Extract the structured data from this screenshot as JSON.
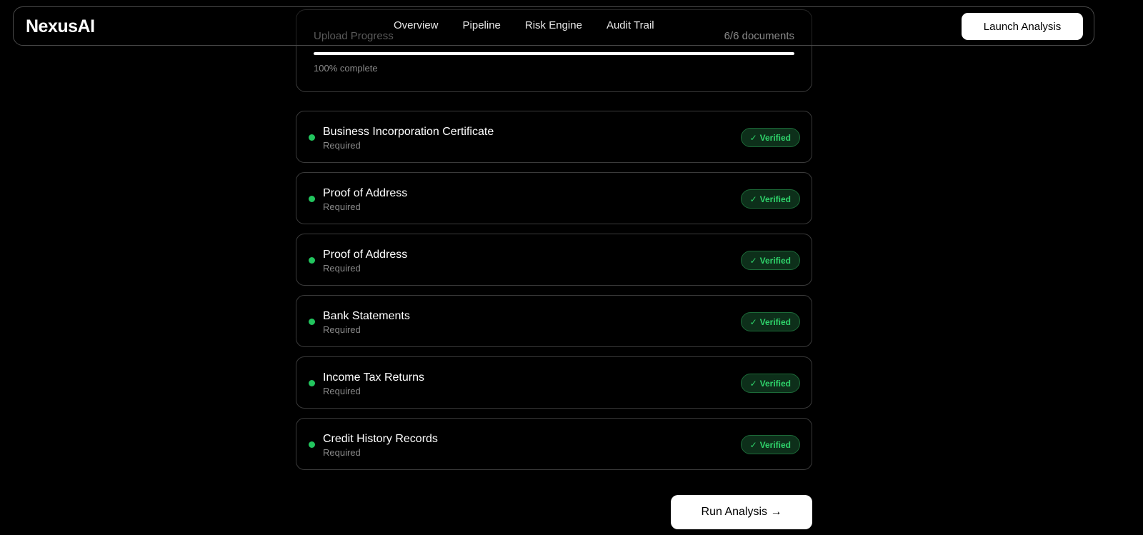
{
  "header": {
    "logo": "NexusAI",
    "nav": [
      "Overview",
      "Pipeline",
      "Risk Engine",
      "Audit Trail"
    ],
    "cta_label": "Launch Analysis"
  },
  "upload": {
    "label": "Upload Progress",
    "count": "6/6 documents",
    "progress_percent": 100,
    "progress_text": "100% complete"
  },
  "documents": [
    {
      "title": "Business Incorporation Certificate",
      "subtitle": "Required",
      "status": "Verified"
    },
    {
      "title": "Proof of Address",
      "subtitle": "Required",
      "status": "Verified"
    },
    {
      "title": "Proof of Address",
      "subtitle": "Required",
      "status": "Verified"
    },
    {
      "title": "Bank Statements",
      "subtitle": "Required",
      "status": "Verified"
    },
    {
      "title": "Income Tax Returns",
      "subtitle": "Required",
      "status": "Verified"
    },
    {
      "title": "Credit History Records",
      "subtitle": "Required",
      "status": "Verified"
    }
  ],
  "actions": {
    "run_label": "Run Analysis →"
  },
  "colors": {
    "accent_green": "#22c55e",
    "background": "#000000"
  },
  "icons": {
    "status_dot": "status-dot-icon",
    "check": "check-icon"
  }
}
